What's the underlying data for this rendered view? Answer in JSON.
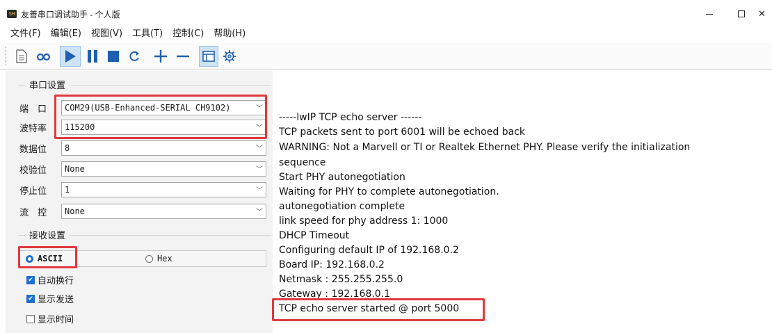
{
  "window": {
    "title": "友善串口调试助手 - 个人版",
    "icon_text": "SH"
  },
  "menu": [
    "文件(F)",
    "编辑(E)",
    "视图(V)",
    "工具(T)",
    "控制(C)",
    "帮助(H)"
  ],
  "toolbar": {
    "buttons": [
      "new-file",
      "loop",
      "start",
      "pause",
      "stop",
      "refresh",
      "add",
      "remove",
      "window-mode",
      "settings"
    ]
  },
  "serial_settings": {
    "title": "串口设置",
    "port_label": "端　口",
    "port_value": "COM29(USB-Enhanced-SERIAL CH9102)",
    "baud_label": "波特率",
    "baud_value": "115200",
    "databits_label": "数据位",
    "databits_value": "8",
    "parity_label": "校验位",
    "parity_value": "None",
    "stopbits_label": "停止位",
    "stopbits_value": "1",
    "flow_label": "流　控",
    "flow_value": "None"
  },
  "receive_settings": {
    "title": "接收设置",
    "ascii_label": "ASCII",
    "hex_label": "Hex",
    "selected": "ASCII",
    "auto_newline_label": "自动换行",
    "show_send_label": "显示发送",
    "show_time_label": "显示时间"
  },
  "receive_lines": [
    "-----lwIP TCP echo server ------",
    "TCP packets sent to port 6001 will be echoed back",
    "WARNING: Not a Marvell or TI or Realtek Ethernet PHY. Please verify the initialization",
    "sequence",
    "Start PHY autonegotiation",
    "Waiting for PHY to complete autonegotiation.",
    "autonegotiation complete",
    "link speed for phy address 1: 1000",
    "DHCP Timeout",
    "Configuring default IP of 192.168.0.2",
    "Board IP: 192.168.0.2",
    "Netmask : 255.255.255.0",
    "Gateway : 192.168.0.1",
    "TCP echo server started @ port 5000"
  ],
  "colors": {
    "highlight": "#e0393e",
    "accent": "#1e6fd0"
  }
}
